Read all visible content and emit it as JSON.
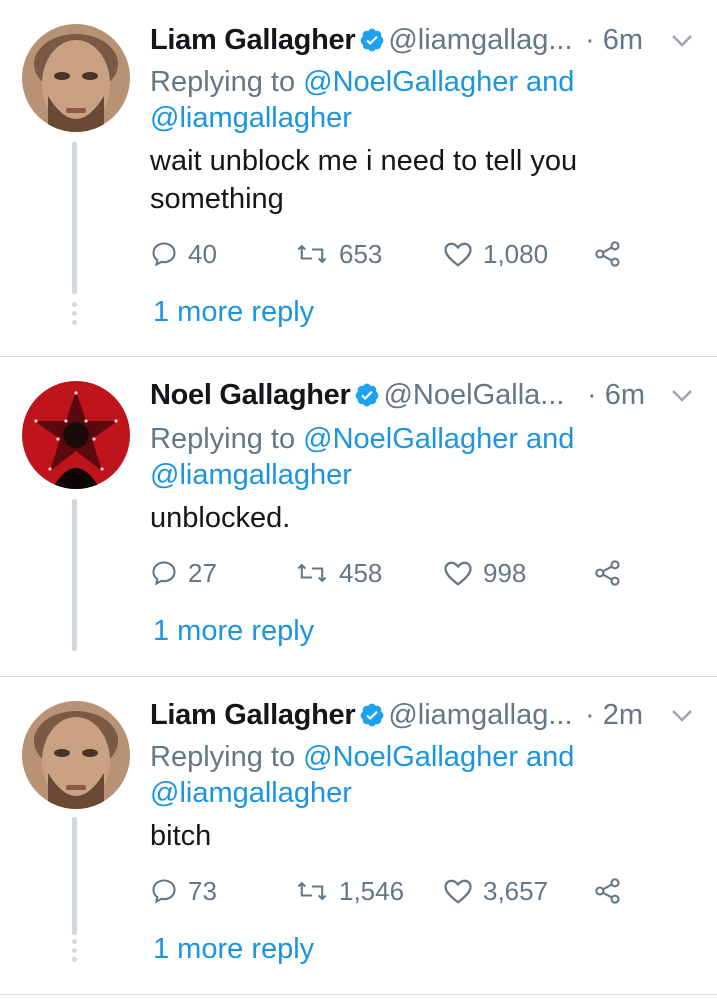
{
  "tweets": [
    {
      "name": "Liam Gallagher",
      "handle": "@liamgallag...",
      "time": "· 6m",
      "replying_prefix": "Replying to",
      "replying_to_1": "@NoelGallagher",
      "replying_and": "and",
      "replying_to_2": "@liamgallagher",
      "text_line_1": "wait unblock me i need to tell you",
      "text_line_2": "something",
      "replies": "40",
      "retweets": "653",
      "likes": "1,080",
      "more_reply": "1 more reply"
    },
    {
      "name": "Noel Gallagher",
      "handle": "@NoelGalla...",
      "time": "· 6m",
      "replying_prefix": "Replying to",
      "replying_to_1": "@NoelGallagher",
      "replying_and": "and",
      "replying_to_2": "@liamgallagher",
      "text_line_1": "unblocked.",
      "replies": "27",
      "retweets": "458",
      "likes": "998",
      "more_reply": "1 more reply"
    },
    {
      "name": "Liam Gallagher",
      "handle": "@liamgallag...",
      "time": "· 2m",
      "replying_prefix": "Replying to",
      "replying_to_1": "@NoelGallagher",
      "replying_and": "and",
      "replying_to_2": "@liamgallagher",
      "text_line_1": "bitch",
      "replies": "73",
      "retweets": "1,546",
      "likes": "3,657",
      "more_reply": "1 more reply"
    }
  ],
  "colors": {
    "link": "#1b95e0",
    "muted": "#657786",
    "text": "#14171a",
    "verified": "#1da1f2",
    "thread_line": "#cfd9de"
  },
  "icons": [
    "verified-badge-icon",
    "chevron-down-icon",
    "reply-icon",
    "retweet-icon",
    "like-icon",
    "share-icon"
  ]
}
